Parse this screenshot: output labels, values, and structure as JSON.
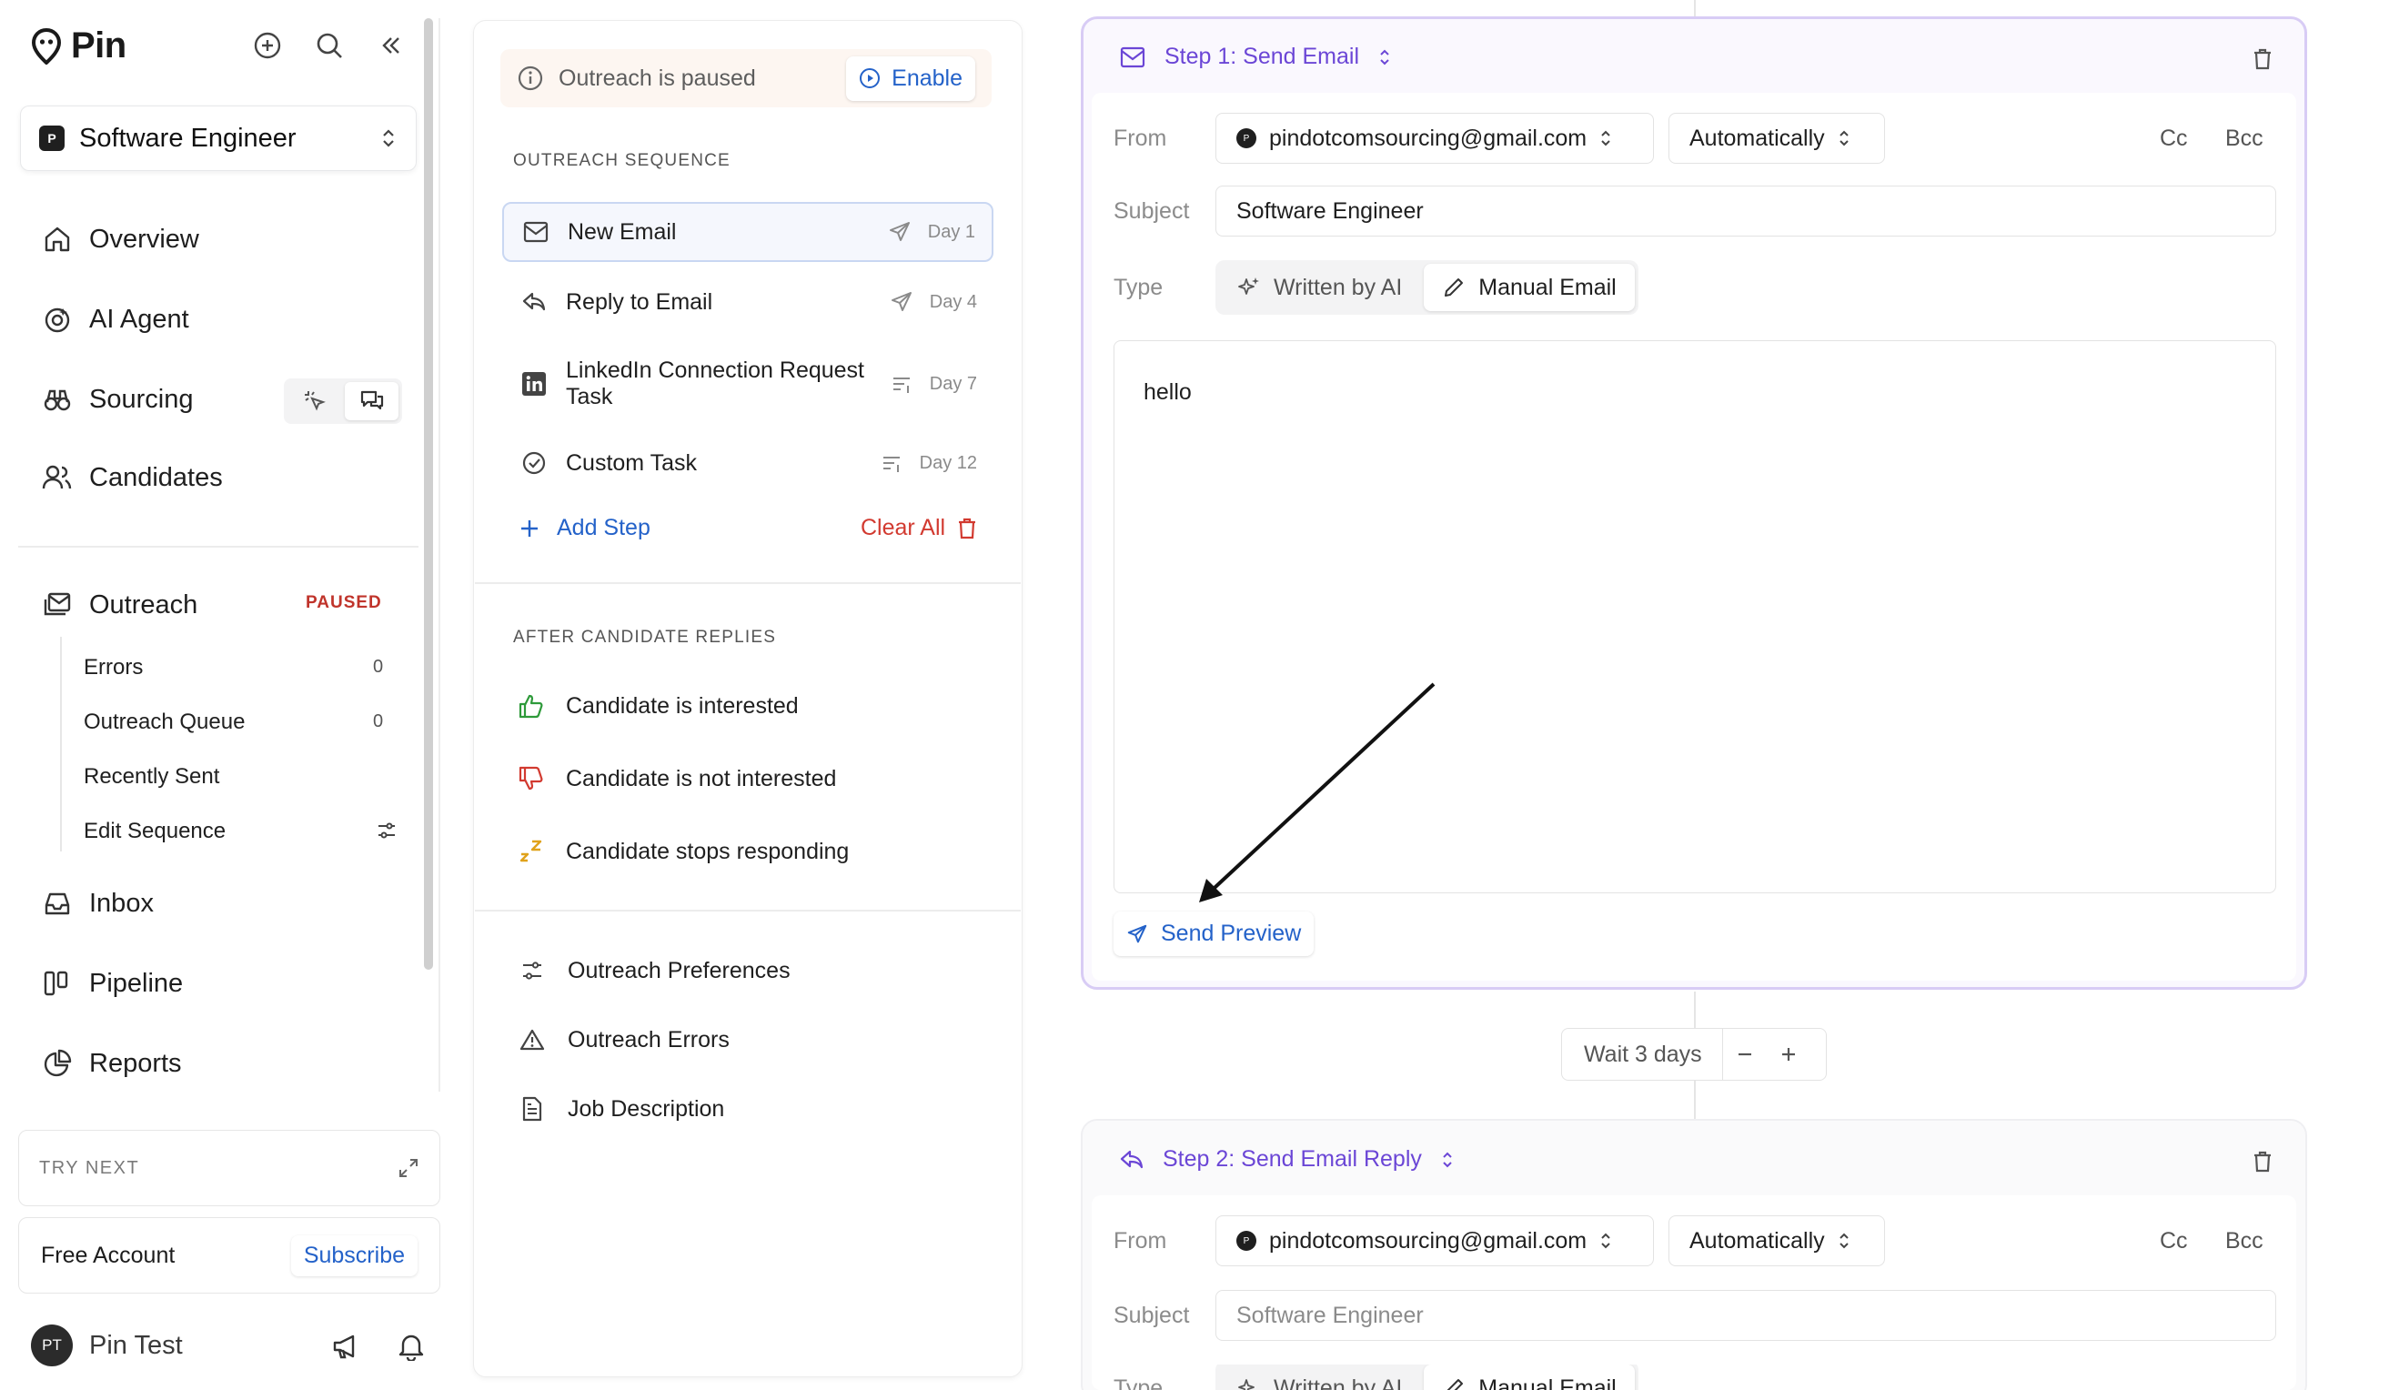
{
  "app": {
    "name": "Pin"
  },
  "sidebar": {
    "job_title": "Software Engineer",
    "job_badge": "P",
    "nav": {
      "overview": "Overview",
      "ai_agent": "AI Agent",
      "sourcing": "Sourcing",
      "candidates": "Candidates",
      "outreach": "Outreach",
      "inbox": "Inbox",
      "pipeline": "Pipeline",
      "reports": "Reports"
    },
    "outreach_badge": "PAUSED",
    "outreach_sub": [
      {
        "label": "Errors",
        "count": "0"
      },
      {
        "label": "Outreach Queue",
        "count": "0"
      },
      {
        "label": "Recently Sent"
      },
      {
        "label": "Edit Sequence"
      }
    ],
    "try_next": "TRY NEXT",
    "plan_label": "Free Account",
    "subscribe": "Subscribe",
    "user": {
      "initials": "PT",
      "name": "Pin Test"
    }
  },
  "sequence": {
    "paused_text": "Outreach is paused",
    "enable": "Enable",
    "section_title": "OUTREACH SEQUENCE",
    "steps": [
      {
        "name": "New Email",
        "day": "Day 1"
      },
      {
        "name": "Reply to Email",
        "day": "Day 4"
      },
      {
        "name": "LinkedIn Connection Request Task",
        "day": "Day 7"
      },
      {
        "name": "Custom Task",
        "day": "Day 12"
      }
    ],
    "add_step": "Add Step",
    "clear_all": "Clear All",
    "after_title": "AFTER CANDIDATE REPLIES",
    "after": [
      {
        "label": "Candidate is interested"
      },
      {
        "label": "Candidate is not interested"
      },
      {
        "label": "Candidate stops responding"
      }
    ],
    "links": [
      {
        "label": "Outreach Preferences"
      },
      {
        "label": "Outreach Errors"
      },
      {
        "label": "Job Description"
      }
    ]
  },
  "editor": {
    "step1": {
      "title": "Step 1: Send Email",
      "from_label": "From",
      "from": "pindotcomsourcing@gmail.com",
      "send_mode": "Automatically",
      "cc": "Cc",
      "bcc": "Bcc",
      "subject_label": "Subject",
      "subject": "Software Engineer",
      "type_label": "Type",
      "type_ai": "Written by AI",
      "type_manual": "Manual Email",
      "body": "hello",
      "send_preview": "Send Preview"
    },
    "wait": {
      "label": "Wait 3 days"
    },
    "step2": {
      "title": "Step 2: Send Email Reply",
      "from_label": "From",
      "from": "pindotcomsourcing@gmail.com",
      "send_mode": "Automatically",
      "cc": "Cc",
      "bcc": "Bcc",
      "subject_label": "Subject",
      "subject_placeholder": "Software Engineer",
      "type_label": "Type",
      "type_ai": "Written by AI",
      "type_manual": "Manual Email"
    }
  },
  "colors": {
    "accent": "#2462c9",
    "step_purple": "#6b46d6",
    "danger": "#d23a30",
    "positive": "#2e9a3a",
    "snooze": "#e0a21b"
  }
}
